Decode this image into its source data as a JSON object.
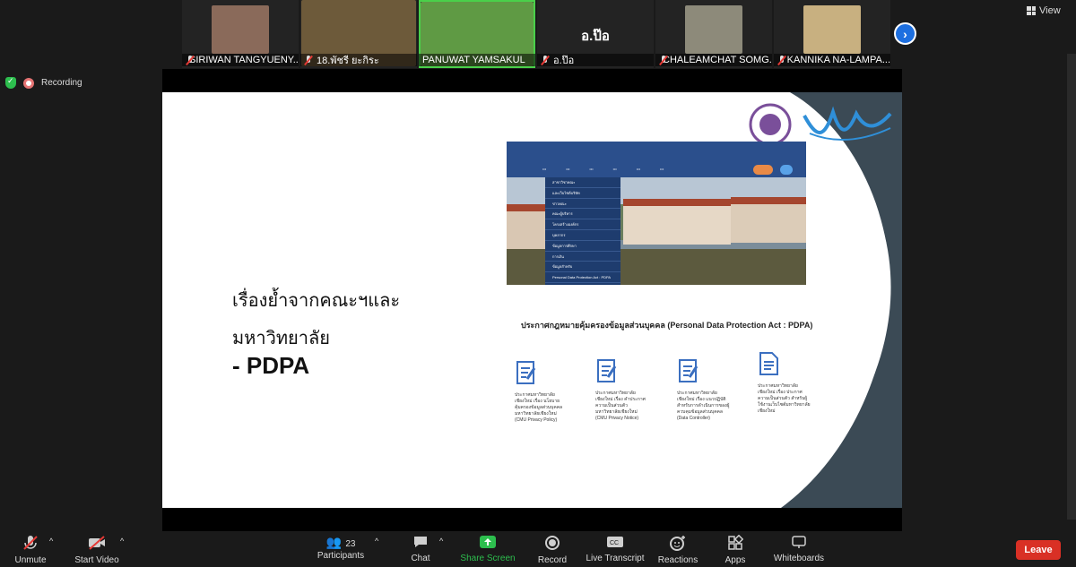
{
  "participants": [
    {
      "name": "SIRIWAN TANGYUENY...",
      "muted": true,
      "face_color": "#8a6a5a"
    },
    {
      "name": "18.พัชรี ยะกิระ",
      "muted": true,
      "face_color": "#6d5a3a"
    },
    {
      "name": "PANUWAT YAMSAKUL",
      "muted": false,
      "face_color": "#4f8a3a",
      "active": true
    },
    {
      "name": "อ.ป๊อ",
      "muted": true,
      "display_text": "อ.ป๊อ"
    },
    {
      "name": "CHALEAMCHAT SOMG...",
      "muted": true,
      "face_color": "#8d8a7a"
    },
    {
      "name": "KANNIKA NA-LAMPA...",
      "muted": true,
      "face_color": "#c8b080"
    }
  ],
  "view_label": "View",
  "recording_label": "Recording",
  "slide": {
    "line1": "เรื่องย้ำจากคณะฯและ",
    "line2": "มหาวิทยาลัย",
    "line3": "- PDPA",
    "dropdown_items": [
      "สาขาวิชาคณะ",
      "และเว็บไซต์บริษัท",
      "ข่าวคณะ",
      "คณะผู้บริหาร",
      "โครงสร้างองค์กร",
      "บุคลากร",
      "ข้อมูลการศึกษา",
      "การเงิน",
      "ข้อมูลสำหรับ",
      "Personal Data Protection Act : PDPA"
    ],
    "pdpa_title": "ประกาศกฎหมายคุ้มครองข้อมูลส่วนบุคคล (Personal Data Protection Act : PDPA)",
    "docs": [
      "ประกาศมหาวิทยาลัยเชียงใหม่ เรื่อง นโยบายคุ้มครองข้อมูลส่วนบุคคล มหาวิทยาลัยเชียงใหม่ (CMU Privacy Policy)",
      "ประกาศมหาวิทยาลัยเชียงใหม่ เรื่อง คำประกาศความเป็นส่วนตัว มหาวิทยาลัยเชียงใหม่ (CMU Privacy Notice)",
      "ประกาศมหาวิทยาลัยเชียงใหม่ เรื่อง แนวปฏิบัติสำหรับการดำเนินการของผู้ควบคุมข้อมูลส่วนบุคคล (Data Controller)",
      "ประกาศมหาวิทยาลัยเชียงใหม่ เรื่อง ประกาศความเป็นส่วนตัว สำหรับผู้ใช้งานเว็บไซต์มหาวิทยาลัยเชียงใหม่"
    ]
  },
  "toolbar": {
    "unmute": "Unmute",
    "start_video": "Start Video",
    "participants": "Participants",
    "participants_count": "23",
    "chat": "Chat",
    "share_screen": "Share Screen",
    "record": "Record",
    "live_transcript": "Live Transcript",
    "reactions": "Reactions",
    "apps": "Apps",
    "whiteboards": "Whiteboards",
    "leave": "Leave"
  },
  "colors": {
    "accent_green": "#2dbe4e",
    "leave_red": "#d93025",
    "active_speaker": "#4ad04a"
  }
}
